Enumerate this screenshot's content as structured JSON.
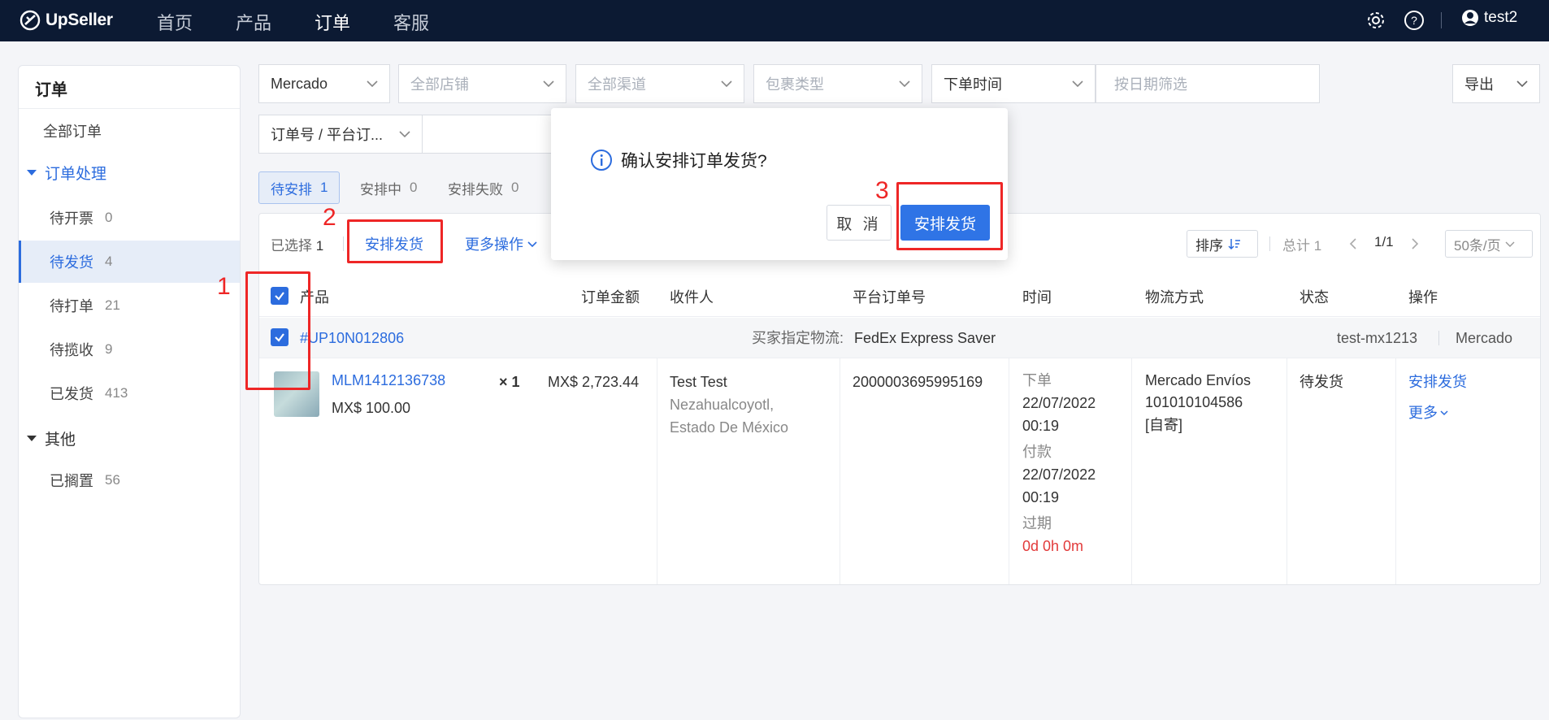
{
  "nav": {
    "logo": "UpSeller",
    "links": [
      "首页",
      "产品",
      "订单",
      "客服"
    ],
    "user": "test2"
  },
  "sidebar": {
    "title": "订单",
    "all": "全部订单",
    "group1": "订单处理",
    "items": [
      {
        "label": "待开票",
        "count": "0"
      },
      {
        "label": "待发货",
        "count": "4"
      },
      {
        "label": "待打单",
        "count": "21"
      },
      {
        "label": "待揽收",
        "count": "9"
      },
      {
        "label": "已发货",
        "count": "413"
      }
    ],
    "group2": "其他",
    "other_items": [
      {
        "label": "已搁置",
        "count": "56"
      }
    ]
  },
  "filters": {
    "platform": "Mercado",
    "store": "全部店铺",
    "channel": "全部渠道",
    "package": "包裹类型",
    "time_type": "下单时间",
    "date_placeholder": "按日期筛选",
    "export": "导出",
    "search_type": "订单号 / 平台订..."
  },
  "subtabs": [
    {
      "label": "待安排",
      "count": "1"
    },
    {
      "label": "安排中",
      "count": "0"
    },
    {
      "label": "安排失败",
      "count": "0"
    }
  ],
  "toolbar": {
    "selected_label": "已选择",
    "selected_count": "1",
    "arrange_ship": "安排发货",
    "more_ops": "更多操作",
    "sort": "排序",
    "total": "总计 1",
    "page": "1/1",
    "page_size": "50条/页"
  },
  "table": {
    "headers": [
      "产品",
      "订单金额",
      "收件人",
      "平台订单号",
      "时间",
      "物流方式",
      "状态",
      "操作"
    ],
    "order": {
      "id": "#UP10N012806",
      "buyer_logistics_label": "买家指定物流:",
      "buyer_logistics": "FedEx Express Saver",
      "store": "test-mx1213",
      "platform": "Mercado",
      "sku": "MLM1412136738",
      "unit_price": "MX$ 100.00",
      "qty": "× 1",
      "amount": "MX$ 2,723.44",
      "recipient_name": "Test Test",
      "recipient_city": "Nezahualcoyotl,",
      "recipient_state": "Estado De México",
      "platform_order_no": "2000003695995169",
      "order_label": "下单",
      "order_date": "22/07/2022",
      "order_time": "00:19",
      "pay_label": "付款",
      "pay_date": "22/07/2022",
      "pay_time": "00:19",
      "overdue_label": "过期",
      "overdue_value": "0d 0h 0m",
      "logistics_name": "Mercado Envíos",
      "logistics_no": "101010104586",
      "logistics_type": "[自寄]",
      "status": "待发货",
      "action_ship": "安排发货",
      "action_more": "更多"
    }
  },
  "modal": {
    "title": "确认安排订单发货?",
    "cancel": "取 消",
    "confirm": "安排发货"
  },
  "annotations": [
    "1",
    "2",
    "3"
  ],
  "colors": {
    "primary": "#2c6cde",
    "nav_bg": "#0c1a33",
    "annotation": "#ee2626",
    "overdue": "#e23a3a"
  }
}
